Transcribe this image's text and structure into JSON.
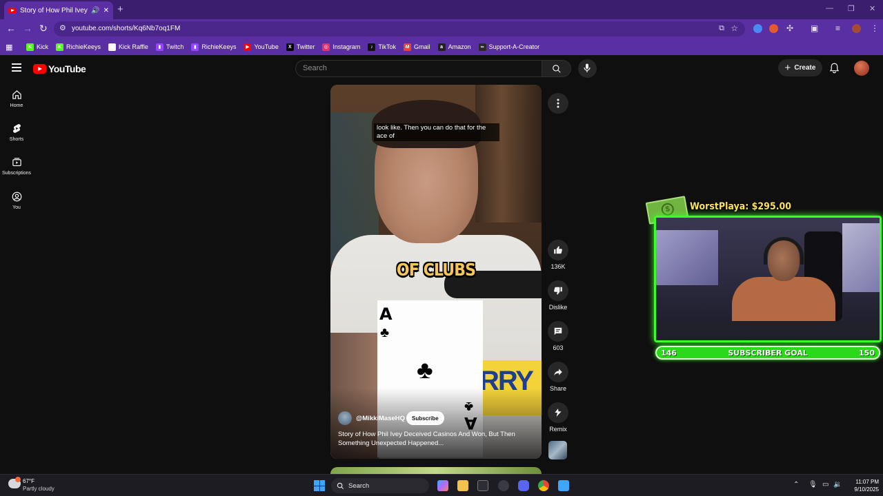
{
  "browser": {
    "tab_title": "Story of How Phil Ivey Dece",
    "new_tab": "+",
    "window_controls": [
      "—",
      "❐",
      "✕"
    ],
    "url": "youtube.com/shorts/Kq6Nb7oq1FM"
  },
  "bookmarks": [
    {
      "label": "Kick",
      "icon": "K",
      "color": "#53fc18"
    },
    {
      "label": "RichieKeeys",
      "icon": "K",
      "color": "#53fc18"
    },
    {
      "label": "Kick Raffle",
      "icon": "◆",
      "color": "#f5f5f5"
    },
    {
      "label": "Twitch",
      "icon": "▮",
      "color": "#9146ff"
    },
    {
      "label": "RichieKeeys",
      "icon": "▮",
      "color": "#9146ff"
    },
    {
      "label": "YouTube",
      "icon": "▶",
      "color": "#ff0000"
    },
    {
      "label": "Twitter",
      "icon": "X",
      "color": "#000000"
    },
    {
      "label": "Instagram",
      "icon": "◎",
      "color": "#e1306c"
    },
    {
      "label": "TikTok",
      "icon": "♪",
      "color": "#111111"
    },
    {
      "label": "Gmail",
      "icon": "M",
      "color": "#ea4335"
    },
    {
      "label": "Amazon",
      "icon": "a",
      "color": "#222222"
    },
    {
      "label": "Support-A-Creator",
      "icon": "∞",
      "color": "#2a2a2a"
    }
  ],
  "youtube": {
    "logo_text": "YouTube",
    "search_placeholder": "Search",
    "create_label": "Create",
    "sidebar": [
      {
        "label": "Home",
        "icon": "home-icon"
      },
      {
        "label": "Shorts",
        "icon": "shorts-icon"
      },
      {
        "label": "Subscriptions",
        "icon": "subscriptions-icon"
      },
      {
        "label": "You",
        "icon": "you-icon"
      }
    ]
  },
  "short": {
    "caption": "look like. Then you can do that for the ace of",
    "overlay_text": "OF CLUBS",
    "card_rank": "A",
    "card_suit": "♣",
    "shirt_text": "RRY",
    "channel": "@MikkiMaseHQ",
    "subscribe_label": "Subscribe",
    "title": "Story of How Phil Ivey Deceived Casinos And Won, But Then Something Unexpected Happened...",
    "actions": [
      {
        "label": "136K",
        "icon": "like-icon"
      },
      {
        "label": "Dislike",
        "icon": "dislike-icon"
      },
      {
        "label": "603",
        "icon": "comments-icon"
      },
      {
        "label": "Share",
        "icon": "share-icon"
      },
      {
        "label": "Remix",
        "icon": "remix-icon"
      }
    ]
  },
  "overlay": {
    "donation": "WorstPlaya: $295.00",
    "bill_symbol": "$",
    "goal_current": "146",
    "goal_label": "SUBSCRIBER GOAL",
    "goal_target": "150"
  },
  "taskbar": {
    "temperature": "67°F",
    "condition": "Partly cloudy",
    "search_label": "Search",
    "time": "11:07 PM",
    "date": "9/10/2025"
  }
}
